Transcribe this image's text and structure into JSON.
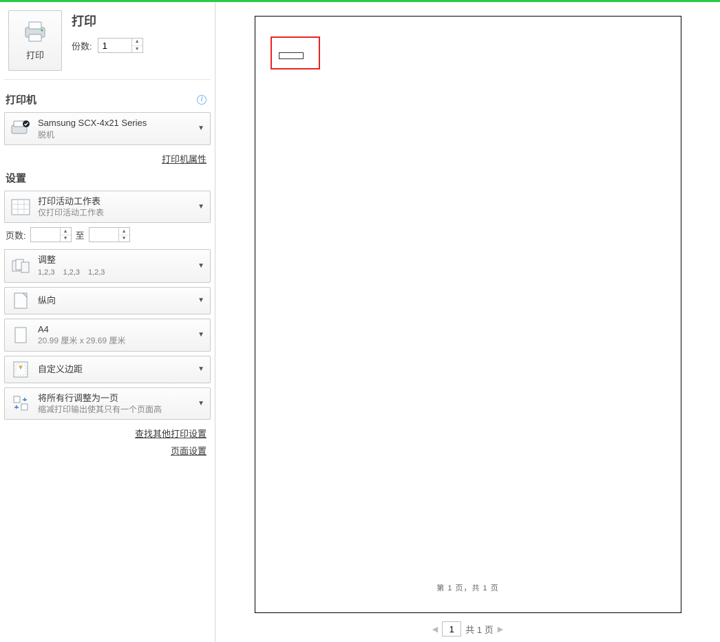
{
  "header": {
    "print_title": "打印",
    "print_button_label": "打印",
    "copies_label": "份数:",
    "copies_value": "1"
  },
  "printer_section": {
    "title": "打印机",
    "info_tooltip": "i",
    "selected_name": "Samsung SCX-4x21 Series",
    "selected_status": "脱机",
    "properties_link": "打印机属性"
  },
  "settings_section": {
    "title": "设置",
    "what_to_print": {
      "primary": "打印活动工作表",
      "secondary": "仅打印活动工作表"
    },
    "pages_label": "页数:",
    "pages_from": "",
    "pages_to_label": "至",
    "pages_to": "",
    "collate": {
      "primary": "调整",
      "seq": [
        "1,2,3",
        "1,2,3",
        "1,2,3"
      ]
    },
    "orientation": {
      "primary": "纵向"
    },
    "paper": {
      "primary": "A4",
      "secondary": "20.99 厘米 x 29.69 厘米"
    },
    "margins": {
      "primary": "自定义边距"
    },
    "scaling": {
      "primary": "将所有行调整为一页",
      "secondary": "缩减打印输出使其只有一个页面高"
    },
    "other_settings_link": "查找其他打印设置",
    "page_setup_link": "页面设置"
  },
  "preview": {
    "footer_text": "第 1 页，共 1 页"
  },
  "pager": {
    "current": "1",
    "total_text": "共 1 页"
  }
}
